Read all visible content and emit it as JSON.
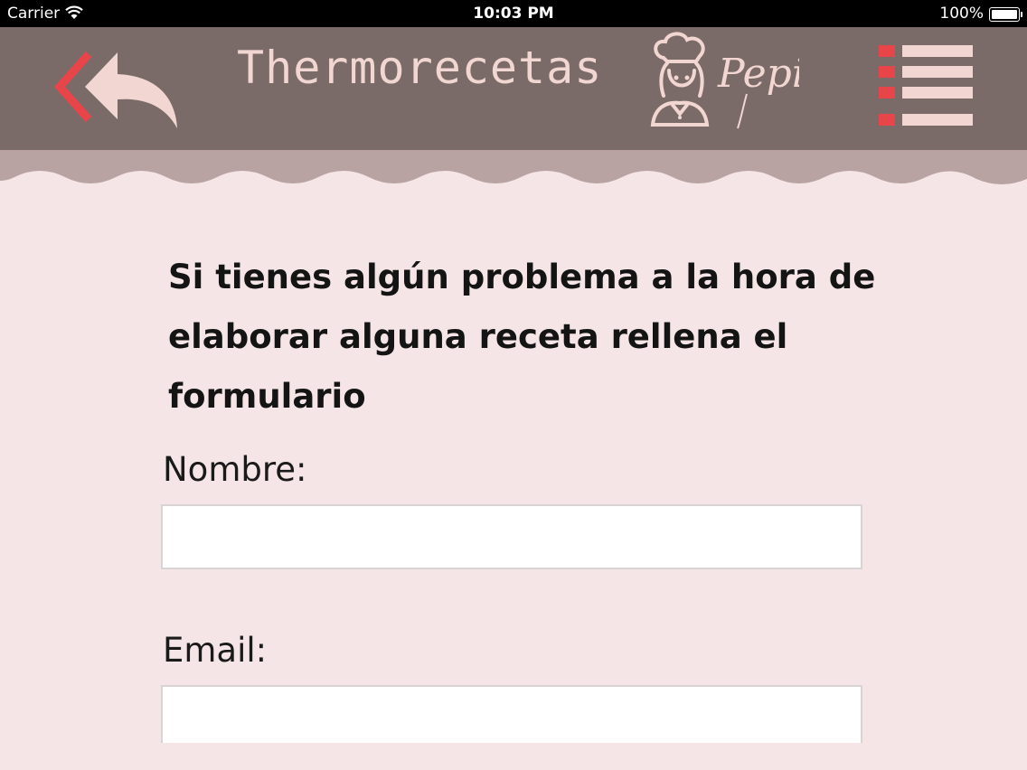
{
  "status_bar": {
    "carrier": "Carrier",
    "time": "10:03 PM",
    "battery": "100%",
    "battery_level": 1.0
  },
  "header": {
    "title": "Thermorecetas",
    "signature": "Pepi",
    "icons": {
      "back": "double-chevron-reply-icon",
      "logo": "chef-logo-icon",
      "menu": "hamburger-menu-icon"
    },
    "colors": {
      "bar": "#7a6b68",
      "accent": "#e8454a",
      "light": "#f2d6d2",
      "wave": "#b8a3a2"
    }
  },
  "form": {
    "heading": "Si tienes algún problema a la hora de elaborar alguna receta rellena el formulario",
    "name_label": "Nombre:",
    "name_value": "",
    "email_label": "Email:",
    "email_value": ""
  },
  "colors": {
    "background": "#f5e5e6"
  }
}
